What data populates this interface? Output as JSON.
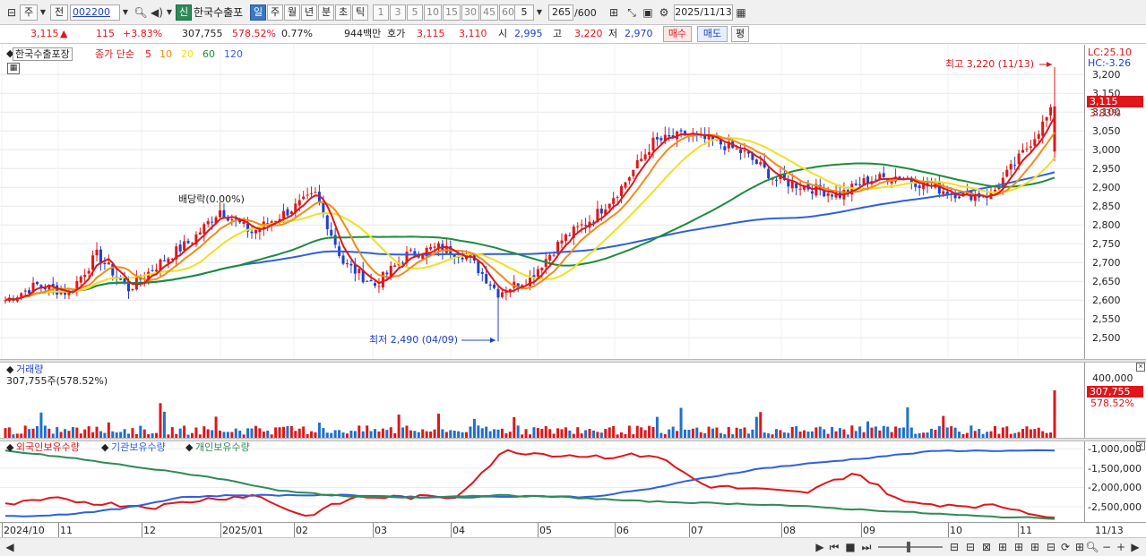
{
  "toolbar": {
    "period_label": "주",
    "prev_label": "전",
    "code": "002200",
    "sin_label": "신",
    "stock_name": "한국수출포",
    "period_tabs": [
      "일",
      "주",
      "월",
      "년",
      "분",
      "초",
      "틱"
    ],
    "interval_buttons": [
      "1",
      "3",
      "5",
      "10",
      "15",
      "30",
      "45",
      "60"
    ],
    "interval_value": "5",
    "count": "265",
    "count_max": "/600",
    "date": "2025/11/13"
  },
  "quote": {
    "price": "3,115",
    "change_arrow": "▲",
    "change": "115",
    "change_pct": "+3.83%",
    "volume": "307,755",
    "volume_pct": "578.52%",
    "turnover_pct": "0.77%",
    "amount": "944백만",
    "hoga_label": "호가",
    "ask": "3,115",
    "bid": "3,110",
    "open_label": "시",
    "open": "2,995",
    "high_label": "고",
    "high": "3,220",
    "low_label": "저",
    "low": "2,970",
    "buy_label": "매수",
    "sell_label": "매도",
    "eval_label": "평"
  },
  "price_panel": {
    "name": "한국수출포장",
    "type_label": "종가 단순",
    "ma_periods": [
      "5",
      "10",
      "20",
      "60",
      "120"
    ],
    "ma_colors": [
      "#e0161a",
      "#f08c1a",
      "#f0e020",
      "#1e8c3c",
      "#2f5fe0"
    ],
    "dividend_label": "배당락(0.00%)",
    "high_annotation": "최고 3,220 (11/13)",
    "low_annotation": "최저 2,490 (04/09)",
    "lc_label": "LC:25.10",
    "hc_label": "HC:-3.26",
    "current_price_tag": "3,115",
    "current_pct_tag": "3.83%"
  },
  "volume_panel": {
    "title": "거래량",
    "value_label": "307,755주(578.52%)",
    "axis_label": "400,000",
    "tag_value": "307,755",
    "tag_pct": "578.52%"
  },
  "holding_panel": {
    "legend": [
      "외국인보유수량",
      "기관보유수량",
      "개인보유수량"
    ],
    "colors": [
      "#e0161a",
      "#2f5fe0",
      "#2e8b57"
    ],
    "axis_labels": [
      "-1,000,000",
      "-1,500,000",
      "-2,000,000",
      "-2,500,000"
    ]
  },
  "dates": [
    "2024/10",
    "11",
    "12",
    "2025/01",
    "02",
    "03",
    "04",
    "05",
    "06",
    "07",
    "08",
    "09",
    "10",
    "11"
  ],
  "date_end": "11/13",
  "chart_data": [
    {
      "type": "candlestick",
      "title": "한국수출포장",
      "ylim": [
        2460,
        3260
      ],
      "yticks": [
        2500,
        2550,
        2600,
        2650,
        2700,
        2750,
        2800,
        2850,
        2900,
        2950,
        3000,
        3050,
        3100,
        3150,
        3200
      ],
      "close_anchors": [
        {
          "date": "2024/10",
          "value": 2600
        },
        {
          "date": "10/20",
          "value": 2640
        },
        {
          "date": "11/01",
          "value": 2620
        },
        {
          "date": "11/12",
          "value": 2720
        },
        {
          "date": "11/25",
          "value": 2630
        },
        {
          "date": "12/05",
          "value": 2700
        },
        {
          "date": "12/20",
          "value": 2760
        },
        {
          "date": "2025/01/03",
          "value": 2840
        },
        {
          "date": "01/15",
          "value": 2780
        },
        {
          "date": "01/28",
          "value": 2830
        },
        {
          "date": "02/05",
          "value": 2880
        },
        {
          "date": "02/10",
          "value": 2700
        },
        {
          "date": "02/20",
          "value": 2640
        },
        {
          "date": "03/05",
          "value": 2720
        },
        {
          "date": "03/20",
          "value": 2740
        },
        {
          "date": "04/01",
          "value": 2720
        },
        {
          "date": "04/09",
          "value": 2620
        },
        {
          "date": "04/20",
          "value": 2660
        },
        {
          "date": "05/05",
          "value": 2760
        },
        {
          "date": "05/25",
          "value": 2820
        },
        {
          "date": "06/05",
          "value": 2900
        },
        {
          "date": "06/15",
          "value": 3020
        },
        {
          "date": "06/25",
          "value": 3040
        },
        {
          "date": "07/05",
          "value": 3020
        },
        {
          "date": "07/20",
          "value": 2990
        },
        {
          "date": "08/01",
          "value": 2920
        },
        {
          "date": "08/15",
          "value": 2900
        },
        {
          "date": "09/01",
          "value": 2880
        },
        {
          "date": "09/15",
          "value": 2920
        },
        {
          "date": "10/01",
          "value": 2930
        },
        {
          "date": "10/15",
          "value": 2900
        },
        {
          "date": "10/25",
          "value": 2880
        },
        {
          "date": "11/05",
          "value": 2880
        },
        {
          "date": "11/11",
          "value": 2990
        },
        {
          "date": "11/13",
          "value": 3115
        }
      ],
      "high": {
        "date": "11/13",
        "value": 3220
      },
      "low": {
        "date": "04/09",
        "value": 2490
      },
      "moving_averages": [
        {
          "name": "5",
          "color": "#e0161a"
        },
        {
          "name": "10",
          "color": "#f08c1a"
        },
        {
          "name": "20",
          "color": "#f0e020"
        },
        {
          "name": "60",
          "color": "#1e8c3c"
        },
        {
          "name": "120",
          "color": "#2f5fe0"
        }
      ]
    },
    {
      "type": "bar",
      "title": "거래량",
      "ylim": [
        0,
        400000
      ],
      "last_value": 307755,
      "last_pct": "578.52%"
    },
    {
      "type": "line",
      "title": "보유수량",
      "ylim": [
        -2800000,
        -900000
      ],
      "series": [
        {
          "name": "외국인보유수량",
          "color": "#e0161a",
          "values": [
            -2450000,
            -2300000,
            -2420000,
            -2500000,
            -2300000,
            -2200000,
            -2750000,
            -2250000,
            -2250000,
            -2250000,
            -1050000,
            -1150000,
            -1200000,
            -1150000,
            -1950000,
            -2050000,
            -2150000,
            -1600000,
            -2400000,
            -2450000,
            -2500000,
            -2780000
          ]
        },
        {
          "name": "기관보유수량",
          "color": "#2f5fe0",
          "values": [
            -2750000,
            -2700000,
            -2550000,
            -2250000,
            -2200000,
            -2200000,
            -2200000,
            -2250000,
            -2250000,
            -2220000,
            -2250000,
            -2050000,
            -1750000,
            -1500000,
            -1350000,
            -1200000,
            -1050000,
            -1050000,
            -1050000
          ]
        },
        {
          "name": "개인보유수량",
          "color": "#2e8b57",
          "values": [
            -1050000,
            -1250000,
            -1500000,
            -1750000,
            -2100000,
            -2250000,
            -2250000,
            -2200000,
            -2250000,
            -2350000,
            -2400000,
            -2450000,
            -2550000,
            -2650000,
            -2750000,
            -2800000
          ]
        }
      ]
    }
  ]
}
